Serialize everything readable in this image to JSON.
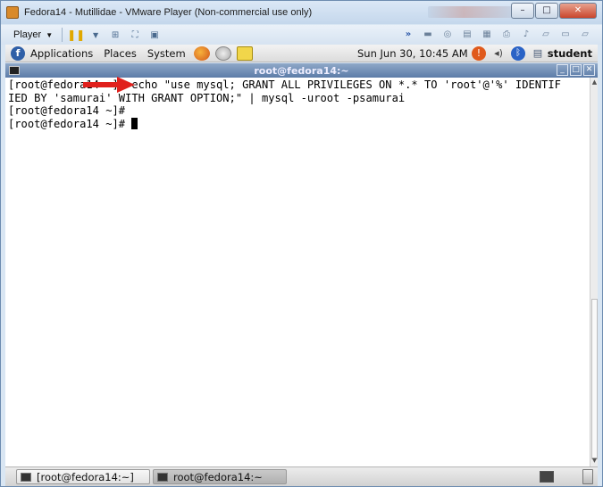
{
  "vmware": {
    "title": "Fedora14 - Mutillidae - VMware Player (Non-commercial use only)",
    "player_label": "Player",
    "controls": {
      "minimize": "–",
      "maximize": "□",
      "close": "✕"
    }
  },
  "gnome_panel": {
    "menus": [
      "Applications",
      "Places",
      "System"
    ],
    "clock": "Sun Jun 30, 10:45 AM",
    "user": "student"
  },
  "terminal": {
    "title": "root@fedora14:~",
    "lines": [
      "[root@fedora14 ~]# echo \"use mysql; GRANT ALL PRIVILEGES ON *.* TO 'root'@'%' IDENTIF",
      "IED BY 'samurai' WITH GRANT OPTION;\" | mysql -uroot -psamurai",
      "[root@fedora14 ~]#",
      "[root@fedora14 ~]# "
    ],
    "annotation_color": "#e0201c"
  },
  "taskbar": {
    "tasks": [
      "[root@fedora14:~]",
      "root@fedora14:~"
    ]
  }
}
